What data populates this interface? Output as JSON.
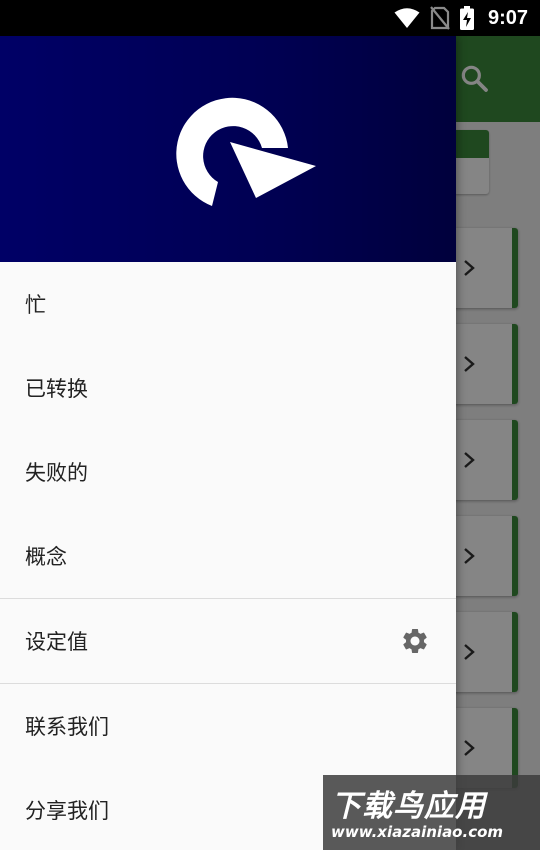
{
  "status_bar": {
    "time": "9:07",
    "icons": [
      "wifi-icon",
      "no-sim-icon",
      "battery-charging-icon"
    ]
  },
  "drawer": {
    "header": {
      "logo_icon": "refresh-arrow-icon",
      "background": "#000066"
    },
    "items": [
      {
        "label": "忙"
      },
      {
        "label": "已转换"
      },
      {
        "label": "失败的"
      },
      {
        "label": "概念"
      },
      {
        "label": "设定值",
        "icon": "gear-icon"
      },
      {
        "label": "联系我们"
      },
      {
        "label": "分享我们"
      }
    ]
  },
  "background_app": {
    "toolbar_icon": "search-icon",
    "accent_color": "#3d8b3d"
  },
  "watermark": {
    "title": "下载鸟应用",
    "url": "www.xiazainiao.com"
  }
}
